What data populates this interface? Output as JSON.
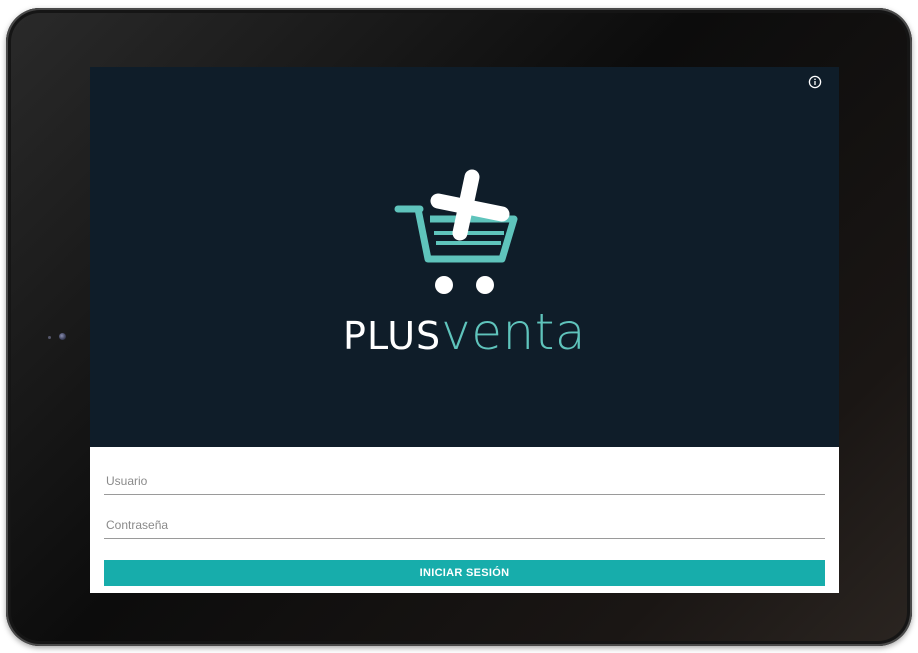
{
  "app": {
    "brand_prefix": "PLUS",
    "brand_suffix": "venta",
    "accent_color": "#5fc4bc",
    "background_color": "#0f1d29",
    "button_color": "#17adab"
  },
  "header": {
    "info_icon": "info-icon"
  },
  "login": {
    "username_placeholder": "Usuario",
    "username_value": "",
    "password_placeholder": "Contraseña",
    "password_value": "",
    "submit_label": "INICIAR SESIÓN"
  }
}
